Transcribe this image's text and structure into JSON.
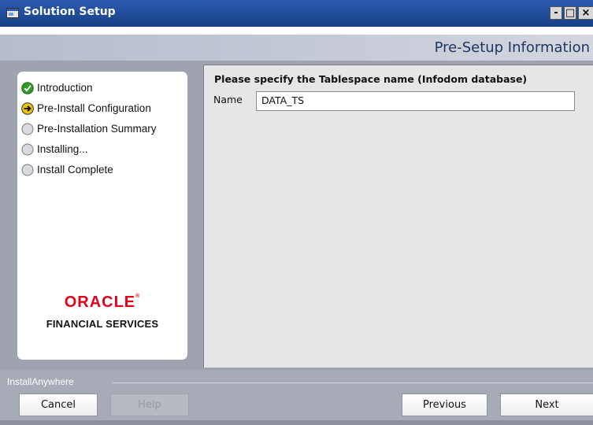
{
  "window": {
    "title": "Solution Setup",
    "controls": {
      "minimize": "-",
      "maximize": "□",
      "close": "×"
    }
  },
  "header": {
    "title": "Pre-Setup Information"
  },
  "steps": [
    {
      "label": "Introduction",
      "status": "complete",
      "icon": "check-circle-icon"
    },
    {
      "label": "Pre-Install Configuration",
      "status": "current",
      "icon": "arrow-circle-icon"
    },
    {
      "label": "Pre-Installation Summary",
      "status": "pending",
      "icon": "empty-circle-icon"
    },
    {
      "label": "Installing...",
      "status": "pending",
      "icon": "empty-circle-icon"
    },
    {
      "label": "Install Complete",
      "status": "pending",
      "icon": "empty-circle-icon"
    }
  ],
  "logo": {
    "brand": "ORACLE",
    "subtitle": "FINANCIAL SERVICES"
  },
  "form": {
    "instruction": "Please specify the Tablespace name (Infodom database)",
    "name_label": "Name",
    "name_value": "DATA_TS"
  },
  "footer": {
    "label": "InstallAnywhere",
    "buttons": {
      "cancel": "Cancel",
      "help": "Help",
      "previous": "Previous",
      "next": "Next"
    }
  },
  "colors": {
    "titlebar": "#1f4b98",
    "oracle_red": "#e2001a",
    "panel_bg": "#9fa3af"
  }
}
